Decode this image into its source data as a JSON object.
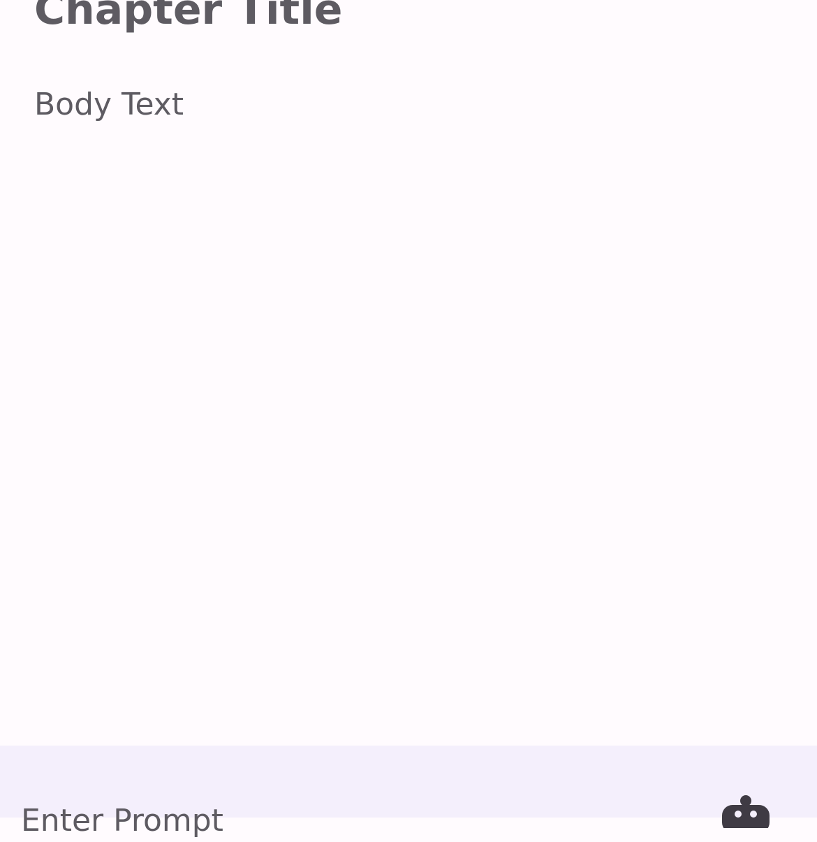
{
  "chapter": {
    "title": "Chapter Title",
    "body": "Body Text"
  },
  "prompt": {
    "placeholder": "Enter Prompt",
    "value": ""
  },
  "icons": {
    "generate": "robot-icon"
  },
  "colors": {
    "background": "#fffbfe",
    "prompt_bar": "#f4effc",
    "text": "#5e5b62",
    "icon": "#3f3b44"
  }
}
